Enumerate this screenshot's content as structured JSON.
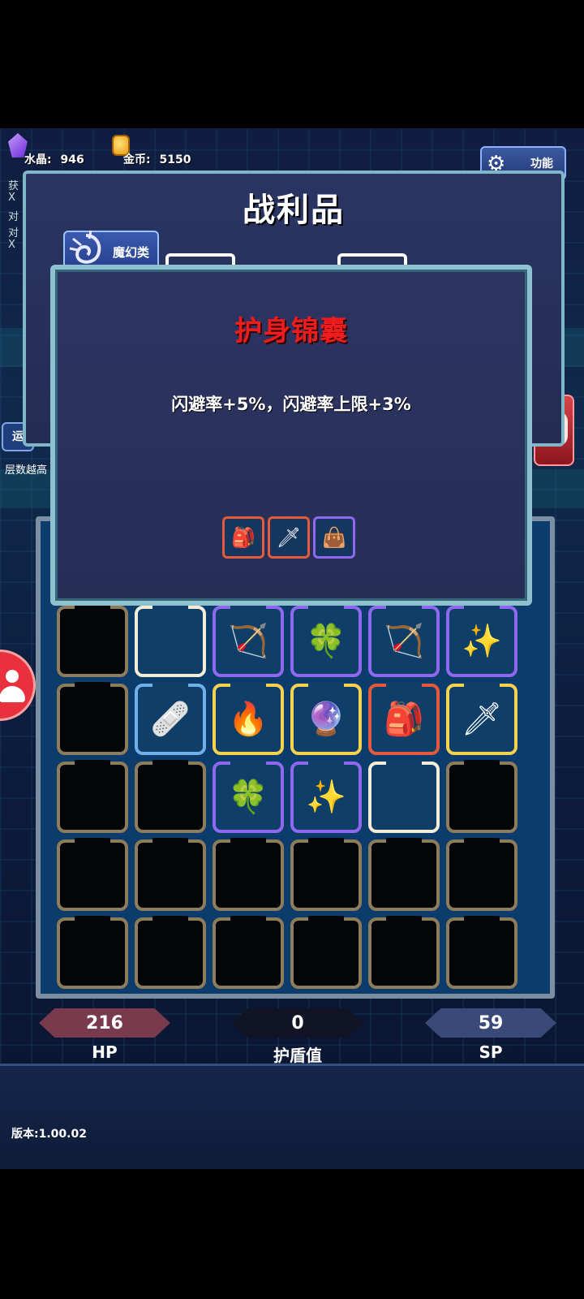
{
  "resources": {
    "crystal_label": "水晶:",
    "crystal_value": "946",
    "gold_label": "金币:",
    "gold_value": "5150"
  },
  "function_button": {
    "label": "功能",
    "icon": "gear-icon"
  },
  "side_text": [
    "获",
    "X",
    "对",
    "对",
    "X"
  ],
  "loot_panel": {
    "title": "战利品",
    "category_label": "魔幻类",
    "category_icon": "swirl-icon"
  },
  "left_button": {
    "label": "运"
  },
  "left_note": "层数越高",
  "item_detail": {
    "name": "护身锦囊",
    "description": "闪避率+5%，闪避率上限+3%",
    "name_color": "#ee1c1c",
    "related_items": [
      {
        "icon": "charm-pouch-icon",
        "glyph": "🎒",
        "rarity_color": "#e55a3c"
      },
      {
        "icon": "golden-sword-icon",
        "glyph": "🗡",
        "rarity_color": "#e55a3c"
      },
      {
        "icon": "cloth-bag-icon",
        "glyph": "👜",
        "rarity_color": "#8e69f0"
      }
    ]
  },
  "inventory": [
    [
      {
        "rarity": "empty",
        "icon": "",
        "glyph": ""
      },
      {
        "rarity": "white",
        "icon": "",
        "glyph": ""
      },
      {
        "rarity": "purple",
        "icon": "bow-icon",
        "glyph": "🏹"
      },
      {
        "rarity": "purple",
        "icon": "clover-icon",
        "glyph": "🍀"
      },
      {
        "rarity": "purple",
        "icon": "bow-icon",
        "glyph": "🏹"
      },
      {
        "rarity": "purple",
        "icon": "magic-arrow-icon",
        "glyph": "✨"
      }
    ],
    [
      {
        "rarity": "empty",
        "icon": "",
        "glyph": ""
      },
      {
        "rarity": "blue",
        "icon": "bandage-icon",
        "glyph": "🩹"
      },
      {
        "rarity": "yellow",
        "icon": "fire-arrow-icon",
        "glyph": "🔥"
      },
      {
        "rarity": "yellow",
        "icon": "staff-icon",
        "glyph": "🔮"
      },
      {
        "rarity": "red",
        "icon": "charm-pouch-icon",
        "glyph": "🎒"
      },
      {
        "rarity": "yellow",
        "icon": "golden-sword-icon",
        "glyph": "🗡"
      }
    ],
    [
      {
        "rarity": "empty",
        "icon": "",
        "glyph": ""
      },
      {
        "rarity": "empty",
        "icon": "",
        "glyph": ""
      },
      {
        "rarity": "purple",
        "icon": "clover-icon",
        "glyph": "🍀"
      },
      {
        "rarity": "purple",
        "icon": "magic-arrow-icon",
        "glyph": "✨"
      },
      {
        "rarity": "white",
        "icon": "",
        "glyph": ""
      },
      {
        "rarity": "empty",
        "icon": "",
        "glyph": ""
      }
    ],
    [
      {
        "rarity": "empty",
        "icon": "",
        "glyph": ""
      },
      {
        "rarity": "empty",
        "icon": "",
        "glyph": ""
      },
      {
        "rarity": "empty",
        "icon": "",
        "glyph": ""
      },
      {
        "rarity": "empty",
        "icon": "",
        "glyph": ""
      },
      {
        "rarity": "empty",
        "icon": "",
        "glyph": ""
      },
      {
        "rarity": "empty",
        "icon": "",
        "glyph": ""
      }
    ],
    [
      {
        "rarity": "empty",
        "icon": "",
        "glyph": ""
      },
      {
        "rarity": "empty",
        "icon": "",
        "glyph": ""
      },
      {
        "rarity": "empty",
        "icon": "",
        "glyph": ""
      },
      {
        "rarity": "empty",
        "icon": "",
        "glyph": ""
      },
      {
        "rarity": "empty",
        "icon": "",
        "glyph": ""
      },
      {
        "rarity": "empty",
        "icon": "",
        "glyph": ""
      }
    ]
  ],
  "stats": {
    "hp_value": "216",
    "hp_label": "HP",
    "shield_value": "0",
    "shield_label": "护盾值",
    "sp_value": "59",
    "sp_label": "SP"
  },
  "version": "版本:1.00.02",
  "colors": {
    "hp": "#7a3a4e",
    "shield": "#101424",
    "sp": "#3a4a78"
  }
}
